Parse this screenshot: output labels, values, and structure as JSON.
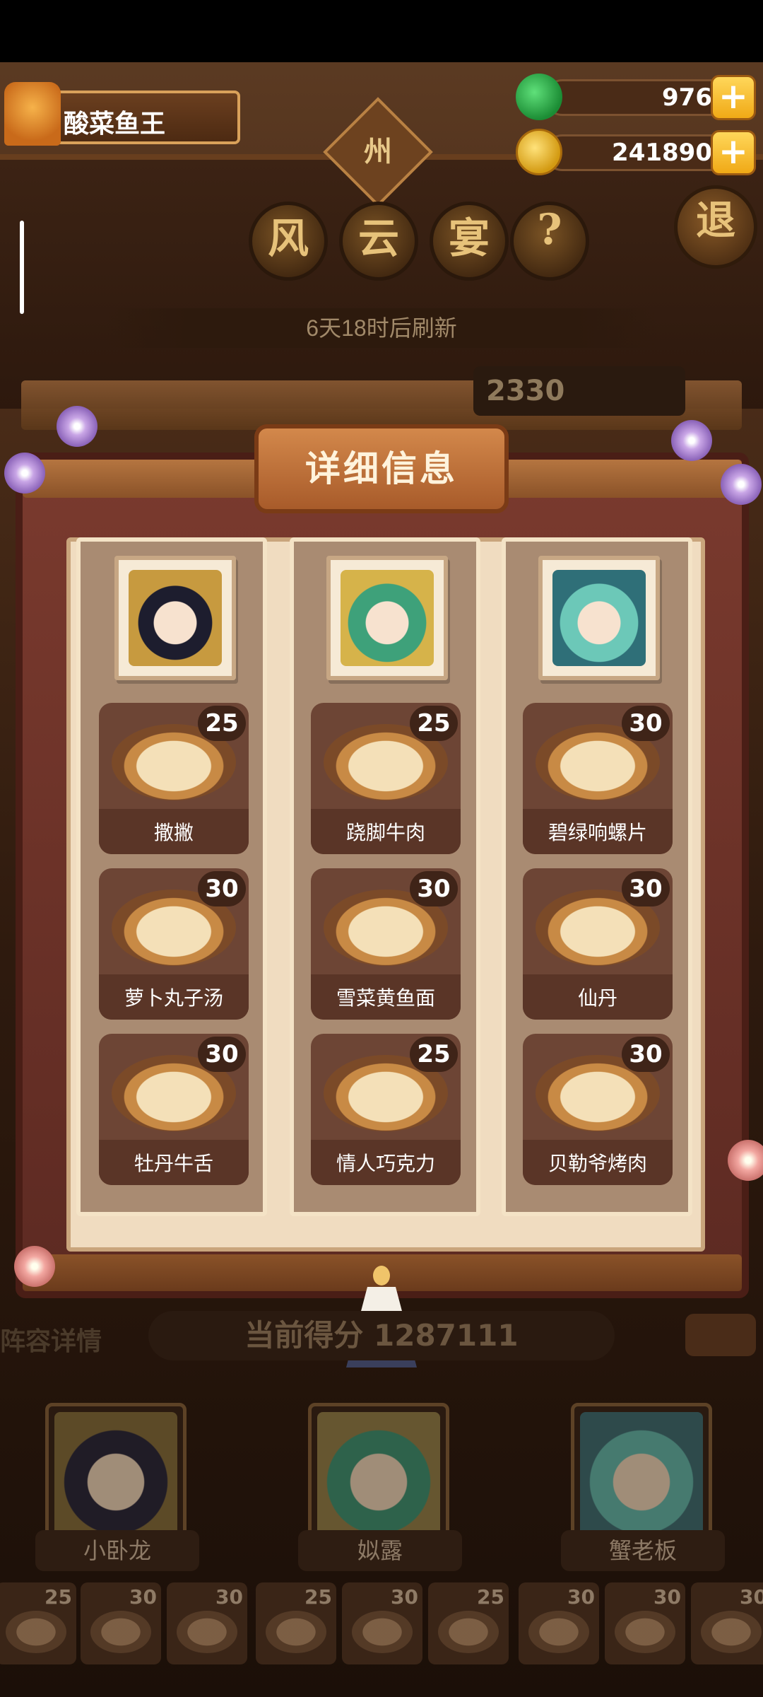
{
  "player": {
    "name": "酸菜鱼王"
  },
  "resources": {
    "jade": "976",
    "coins": "241890",
    "plus_label": "+"
  },
  "header": {
    "state_tag": "州",
    "title_chars": [
      "风",
      "云",
      "宴"
    ],
    "help_label": "?",
    "exit_label": "退",
    "refresh_text": "6天18时后刷新",
    "score_partial": "2330"
  },
  "panel": {
    "title": "详细信息",
    "columns": [
      {
        "dishes": [
          {
            "name": "撒撇",
            "score": "25"
          },
          {
            "name": "萝卜丸子汤",
            "score": "30"
          },
          {
            "name": "牡丹牛舌",
            "score": "30"
          }
        ]
      },
      {
        "dishes": [
          {
            "name": "跷脚牛肉",
            "score": "25"
          },
          {
            "name": "雪菜黄鱼面",
            "score": "30"
          },
          {
            "name": "情人巧克力",
            "score": "25"
          }
        ]
      },
      {
        "dishes": [
          {
            "name": "碧绿响螺片",
            "score": "30"
          },
          {
            "name": "仙丹",
            "score": "30"
          },
          {
            "name": "贝勒爷烤肉",
            "score": "30"
          }
        ]
      }
    ]
  },
  "bottom": {
    "lineup_partial": "阵容详情",
    "current_score_partial": "当前得分 1287111",
    "heroes": [
      {
        "name": "小卧龙"
      },
      {
        "name": "姒露"
      },
      {
        "name": "蟹老板"
      }
    ],
    "tray_scores": [
      "25",
      "30",
      "30",
      "25",
      "30",
      "25",
      "30",
      "30",
      "30"
    ]
  },
  "colors": {
    "panel_bg": "#f0dcc0",
    "accent_gold": "#f0a916",
    "dish_card": "#6d4535"
  }
}
